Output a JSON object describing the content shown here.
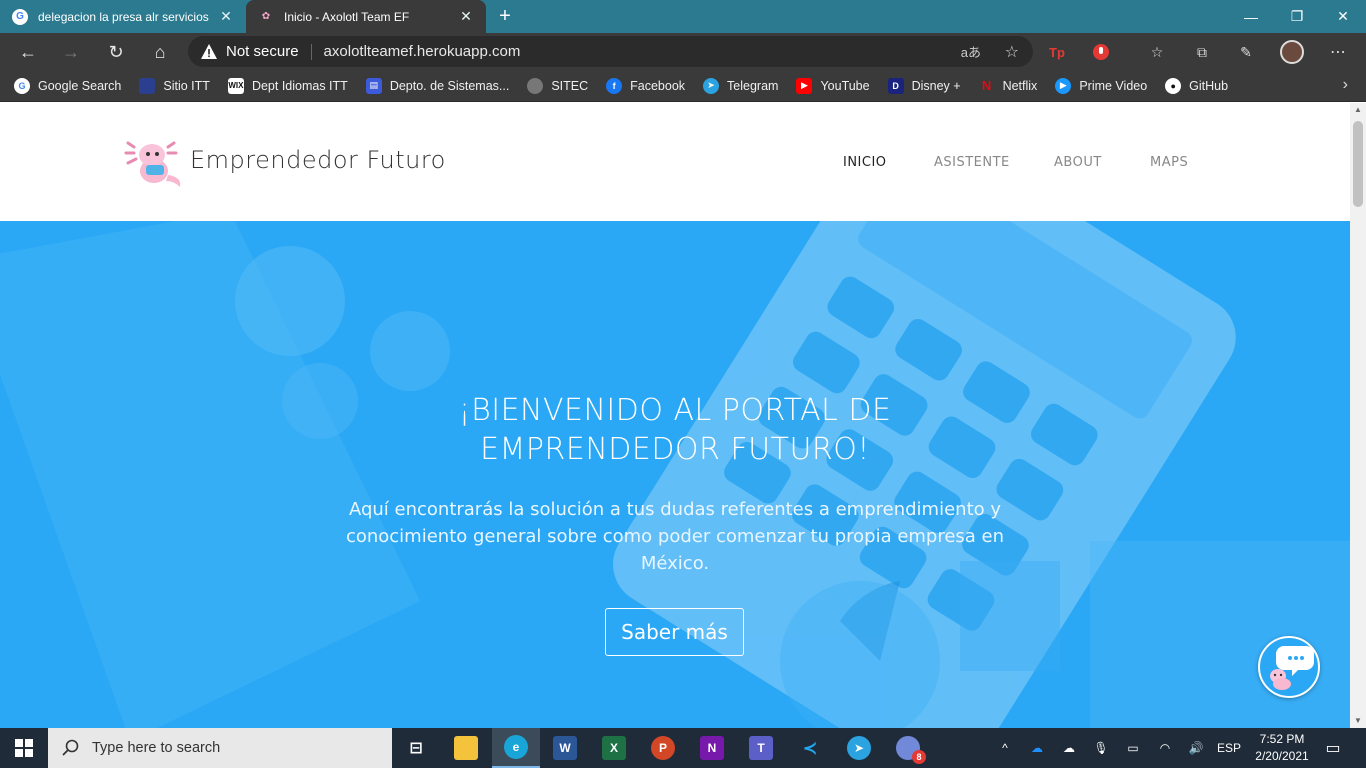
{
  "browser": {
    "tabs": [
      {
        "title": "delegacion la presa alr servicios",
        "active": false
      },
      {
        "title": "Inicio - Axolotl Team EF",
        "active": true
      }
    ],
    "address": {
      "security_label": "Not secure",
      "url": "axolotlteamef.herokuapp.com"
    },
    "bookmarks": [
      {
        "label": "Google Search",
        "icon": "google-icon",
        "color": "#4285f4"
      },
      {
        "label": "Sitio ITT",
        "icon": "itt-icon",
        "color": "#2a3f8f"
      },
      {
        "label": "Dept Idiomas ITT",
        "icon": "wix-icon",
        "color": "#111111"
      },
      {
        "label": "Depto. de Sistemas...",
        "icon": "sistemas-icon",
        "color": "#3b5bdb"
      },
      {
        "label": "SITEC",
        "icon": "sitec-icon",
        "color": "#888888"
      },
      {
        "label": "Facebook",
        "icon": "facebook-icon",
        "color": "#1877f2"
      },
      {
        "label": "Telegram",
        "icon": "telegram-icon",
        "color": "#2aa3e0"
      },
      {
        "label": "YouTube",
        "icon": "youtube-icon",
        "color": "#ff0000"
      },
      {
        "label": "Disney +",
        "icon": "disney-icon",
        "color": "#1a237e"
      },
      {
        "label": "Netflix",
        "icon": "netflix-icon",
        "color": "#e50914"
      },
      {
        "label": "Prime Video",
        "icon": "prime-video-icon",
        "color": "#1a98ff"
      },
      {
        "label": "GitHub",
        "icon": "github-icon",
        "color": "#ffffff"
      }
    ]
  },
  "site": {
    "title": "Emprendedor Futuro",
    "nav": [
      {
        "label": "INICIO",
        "active": true
      },
      {
        "label": "ASISTENTE",
        "active": false
      },
      {
        "label": "ABOUT",
        "active": false
      },
      {
        "label": "MAPS",
        "active": false
      }
    ],
    "hero": {
      "title": "¡BIENVENIDO AL PORTAL DE EMPRENDEDOR FUTURO!",
      "text": "Aquí encontrarás la solución a tus dudas referentes a emprendimiento y conocimiento general sobre como poder comenzar tu propia empresa en México.",
      "button": "Saber más"
    },
    "colors": {
      "hero": "#2aa8f5",
      "header": "#ffffff"
    }
  },
  "taskbar": {
    "search_placeholder": "Type here to search",
    "apps": [
      "task-view-icon",
      "file-explorer-icon",
      "edge-icon",
      "word-icon",
      "excel-icon",
      "powerpoint-icon",
      "onenote-icon",
      "teams-icon",
      "vscode-icon",
      "telegram-icon",
      "discord-icon"
    ],
    "discord_badge": "8",
    "language": "ESP",
    "time": "7:52 PM",
    "date": "2/20/2021"
  }
}
